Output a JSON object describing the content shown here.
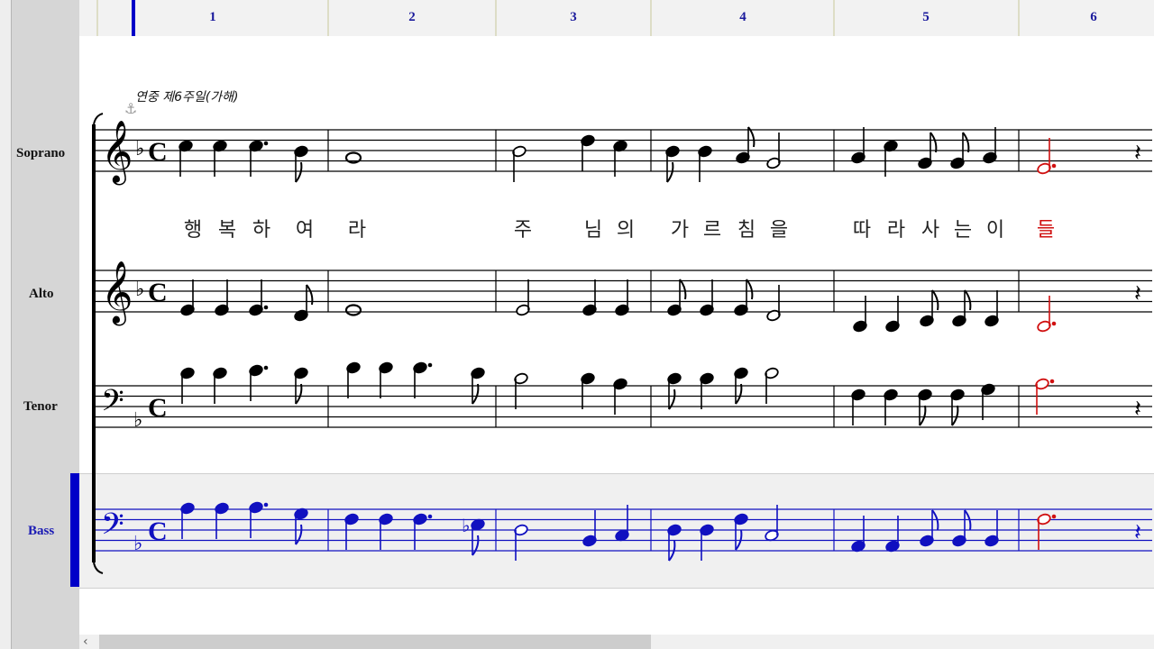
{
  "measure_numbers": [
    "1",
    "2",
    "3",
    "4",
    "5",
    "6"
  ],
  "title_text": "연중 제6주일(가해)",
  "instruments": [
    {
      "name": "Soprano",
      "selected": false
    },
    {
      "name": "Alto",
      "selected": false
    },
    {
      "name": "Tenor",
      "selected": false
    },
    {
      "name": "Bass",
      "selected": true
    }
  ],
  "lyrics": [
    "행",
    "복",
    "하",
    "여",
    "라",
    "주",
    "님",
    "의",
    "가",
    "르",
    "침",
    "을",
    "따",
    "라",
    "사",
    "는",
    "이",
    "들"
  ],
  "time_signature": "C",
  "key_signature": "F major (1 flat)",
  "colors": {
    "normal_notes": "#000000",
    "bass_selected": "#1010c0",
    "current_note": "#d01010",
    "measure_numbers": "#1a1a9c"
  },
  "icons": [
    "anchor-icon",
    "scroll-left-arrow-icon"
  ]
}
